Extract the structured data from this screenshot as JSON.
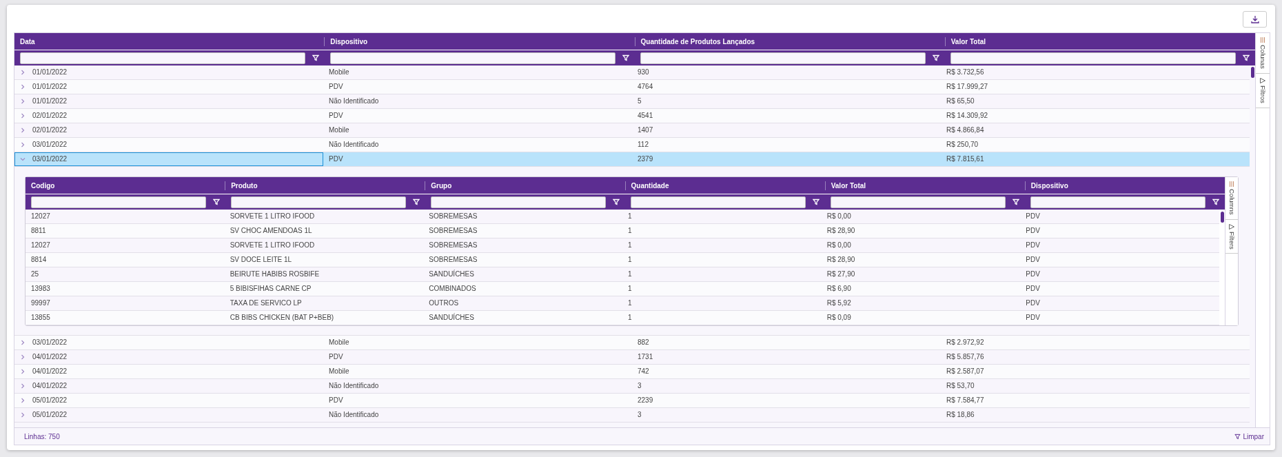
{
  "grid": {
    "columns": [
      "Data",
      "Dispositivo",
      "Quantidade de Produtos Lançados",
      "Valor Total"
    ],
    "rows": [
      {
        "cells": [
          "01/01/2022",
          "Mobile",
          "930",
          "R$ 3.732,56"
        ],
        "expanded": false,
        "selected": false
      },
      {
        "cells": [
          "01/01/2022",
          "PDV",
          "4764",
          "R$ 17.999,27"
        ],
        "expanded": false,
        "selected": false
      },
      {
        "cells": [
          "01/01/2022",
          "Não Identificado",
          "5",
          "R$ 65,50"
        ],
        "expanded": false,
        "selected": false
      },
      {
        "cells": [
          "02/01/2022",
          "PDV",
          "4541",
          "R$ 14.309,92"
        ],
        "expanded": false,
        "selected": false
      },
      {
        "cells": [
          "02/01/2022",
          "Mobile",
          "1407",
          "R$ 4.866,84"
        ],
        "expanded": false,
        "selected": false
      },
      {
        "cells": [
          "03/01/2022",
          "Não Identificado",
          "112",
          "R$ 250,70"
        ],
        "expanded": false,
        "selected": false
      },
      {
        "cells": [
          "03/01/2022",
          "PDV",
          "2379",
          "R$ 7.815,61"
        ],
        "expanded": true,
        "selected": true,
        "detail": {
          "columns": [
            "Codigo",
            "Produto",
            "Grupo",
            "Quantidade",
            "Valor Total",
            "Dispositivo"
          ],
          "rows": [
            [
              "12027",
              "SORVETE 1 LITRO IFOOD",
              "SOBREMESAS",
              "1",
              "R$ 0,00",
              "PDV"
            ],
            [
              "8811",
              "SV CHOC AMENDOAS 1L",
              "SOBREMESAS",
              "1",
              "R$ 28,90",
              "PDV"
            ],
            [
              "12027",
              "SORVETE 1 LITRO IFOOD",
              "SOBREMESAS",
              "1",
              "R$ 0,00",
              "PDV"
            ],
            [
              "8814",
              "SV DOCE LEITE 1L",
              "SOBREMESAS",
              "1",
              "R$ 28,90",
              "PDV"
            ],
            [
              "25",
              "BEIRUTE HABIBS ROSBIFE",
              "SANDUÍCHES",
              "1",
              "R$ 27,90",
              "PDV"
            ],
            [
              "13983",
              "5 BIBISFIHAS CARNE CP",
              "COMBINADOS",
              "1",
              "R$ 6,90",
              "PDV"
            ],
            [
              "99997",
              "TAXA DE SERVICO LP",
              "OUTROS",
              "1",
              "R$ 5,92",
              "PDV"
            ],
            [
              "13855",
              "CB BIBS CHICKEN (BAT P+BEB)",
              "SANDUÍCHES",
              "1",
              "R$ 0,09",
              "PDV"
            ]
          ],
          "side_tabs": [
            {
              "kind": "columns",
              "label": "Columns"
            },
            {
              "kind": "filters",
              "label": "Filters"
            }
          ]
        }
      },
      {
        "cells": [
          "03/01/2022",
          "Mobile",
          "882",
          "R$ 2.972,92"
        ],
        "expanded": false,
        "selected": false
      },
      {
        "cells": [
          "04/01/2022",
          "PDV",
          "1731",
          "R$ 5.857,76"
        ],
        "expanded": false,
        "selected": false
      },
      {
        "cells": [
          "04/01/2022",
          "Mobile",
          "742",
          "R$ 2.587,07"
        ],
        "expanded": false,
        "selected": false
      },
      {
        "cells": [
          "04/01/2022",
          "Não Identificado",
          "3",
          "R$ 53,70"
        ],
        "expanded": false,
        "selected": false
      },
      {
        "cells": [
          "05/01/2022",
          "PDV",
          "2239",
          "R$ 7.584,77"
        ],
        "expanded": false,
        "selected": false
      },
      {
        "cells": [
          "05/01/2022",
          "Não Identificado",
          "3",
          "R$ 18,86"
        ],
        "expanded": false,
        "selected": false
      }
    ],
    "side_tabs": [
      {
        "kind": "columns",
        "label": "Colunas"
      },
      {
        "kind": "filters",
        "label": "Filtros"
      }
    ]
  },
  "status_bar": {
    "row_count": "Linhas: 750",
    "clear_button": "Limpar"
  }
}
